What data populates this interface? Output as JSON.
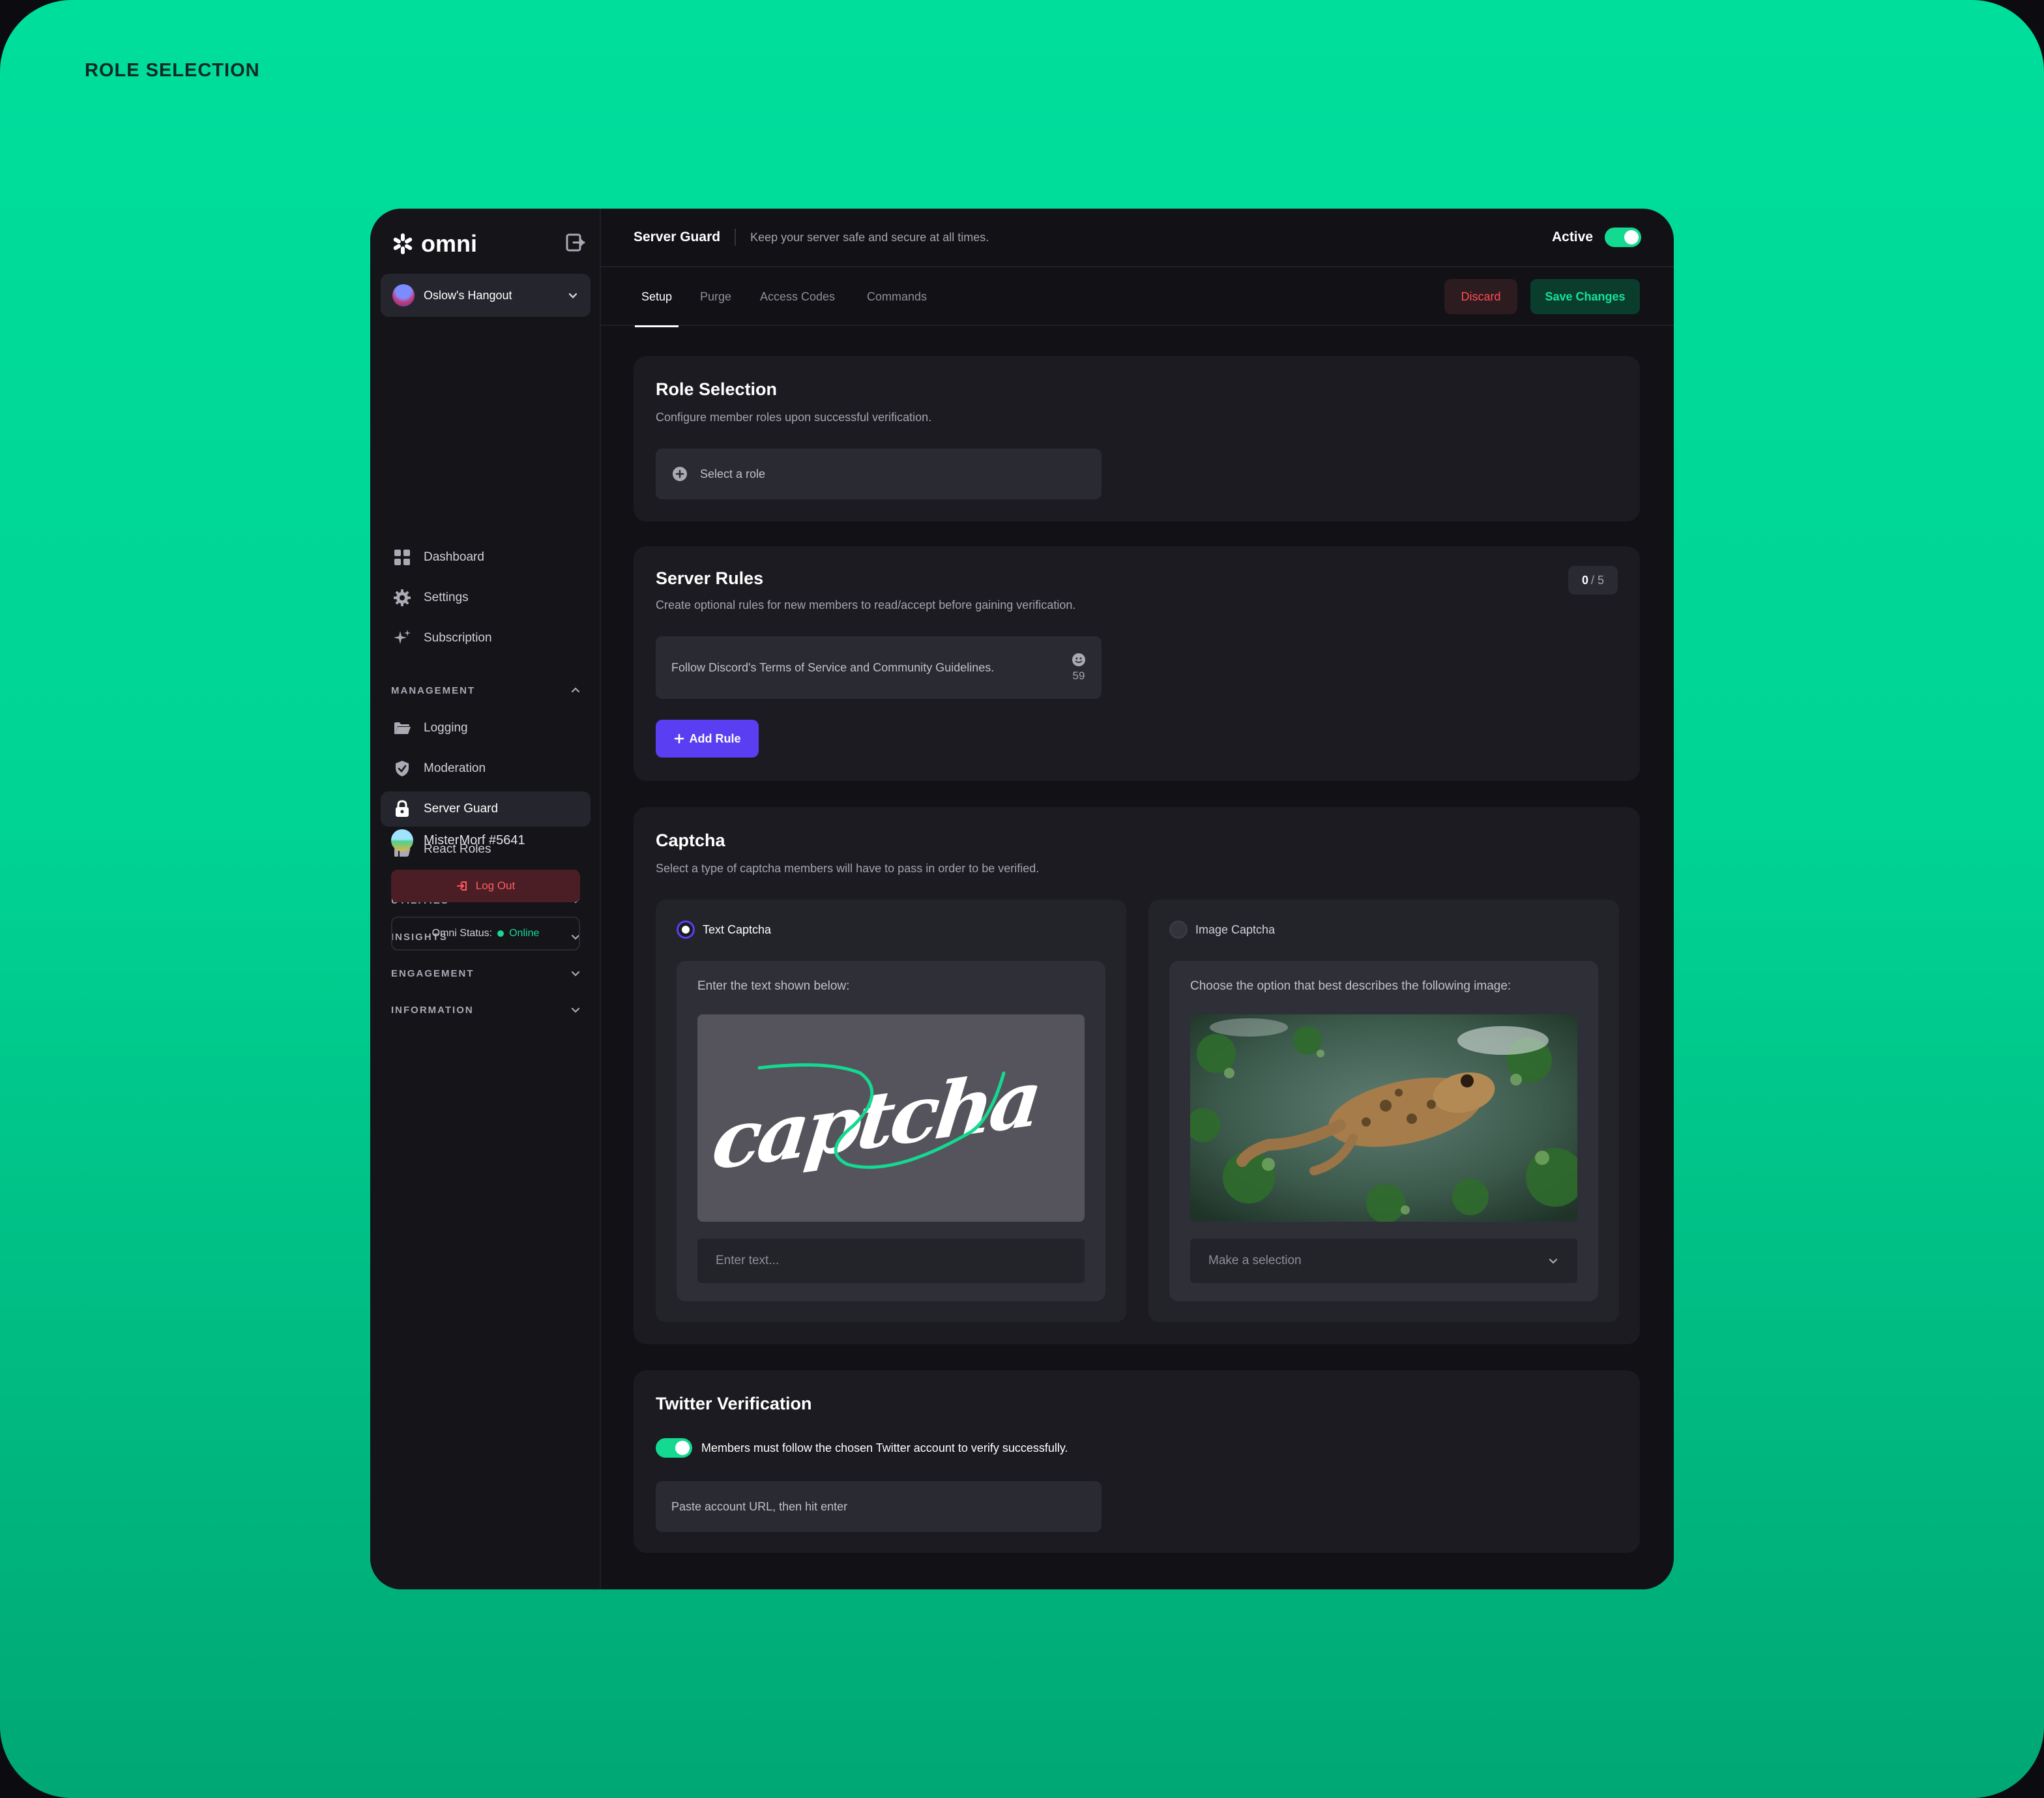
{
  "page_label": "ROLE SELECTION",
  "colors": {
    "accent_green": "#14d990",
    "accent_purple": "#5a3ff2",
    "danger": "#ff4c55",
    "panel": "#1b1b21"
  },
  "sidebar": {
    "brand": "omni",
    "server": "Oslow's Hangout",
    "nav": [
      {
        "label": "Dashboard",
        "icon": "grid-icon"
      },
      {
        "label": "Settings",
        "icon": "gear-icon"
      },
      {
        "label": "Subscription",
        "icon": "sparkle-icon"
      }
    ],
    "management": {
      "title": "MANAGEMENT",
      "items": [
        {
          "label": "Logging",
          "icon": "folder-icon"
        },
        {
          "label": "Moderation",
          "icon": "shield-icon"
        },
        {
          "label": "Server Guard",
          "icon": "lock-icon",
          "active": true
        },
        {
          "label": "React Roles",
          "icon": "thumbs-up-icon"
        }
      ]
    },
    "sections": [
      "UTILITIES",
      "INSIGHTS",
      "ENGAGEMENT",
      "INFORMATION"
    ],
    "user": "MisterMorf #5641",
    "logout": "Log Out",
    "status_label": "Omni Status:",
    "status_value": "Online"
  },
  "header": {
    "title": "Server Guard",
    "subtitle": "Keep your server safe and secure at all times.",
    "active_label": "Active",
    "active": true
  },
  "tabs": [
    "Setup",
    "Purge",
    "Access Codes",
    "Commands"
  ],
  "actions": {
    "discard": "Discard",
    "save": "Save Changes"
  },
  "role_selection": {
    "title": "Role Selection",
    "description": "Configure member roles upon successful verification.",
    "placeholder": "Select a role"
  },
  "server_rules": {
    "title": "Server Rules",
    "description": "Create optional rules for new members to read/accept before gaining verification.",
    "count": "0",
    "max": "/ 5",
    "rule_text": "Follow Discord's Terms of Service and Community Guidelines.",
    "rule_chars": "59",
    "add_button": "Add Rule"
  },
  "captcha": {
    "title": "Captcha",
    "description": "Select a type of captcha members will have to pass in order to be verified.",
    "text_option": {
      "label": "Text Captcha",
      "selected": true,
      "prompt": "Enter the text shown below:",
      "image_text": "captcha",
      "input_placeholder": "Enter text..."
    },
    "image_option": {
      "label": "Image Captcha",
      "selected": false,
      "prompt": "Choose the option that best describes the following image:",
      "select_placeholder": "Make a selection"
    }
  },
  "twitter": {
    "title": "Twitter Verification",
    "toggle_label": "Members must follow the chosen Twitter account to verify successfully.",
    "enabled": true,
    "input_placeholder": "Paste account URL, then hit enter"
  }
}
